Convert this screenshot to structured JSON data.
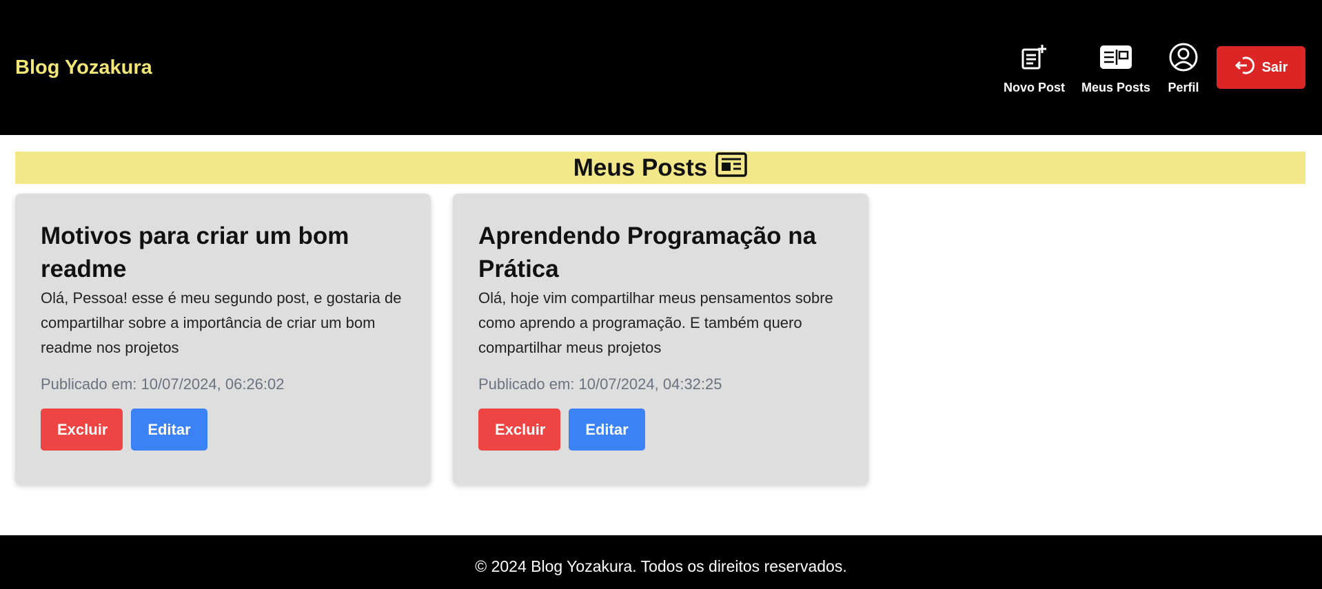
{
  "header": {
    "brand": "Blog Yozakura",
    "nav": [
      {
        "label": "Novo Post",
        "icon": "new-post-icon"
      },
      {
        "label": "Meus Posts",
        "icon": "newspaper-icon"
      },
      {
        "label": "Perfil",
        "icon": "user-circle-icon"
      }
    ],
    "logout_label": "Sair",
    "logout_icon": "logout-arrow-icon"
  },
  "main": {
    "section_title": "Meus Posts",
    "section_icon": "newspaper-icon",
    "posts": [
      {
        "title": "Motivos para criar um bom readme",
        "body": "Olá, Pessoa! esse é meu segundo post, e gostaria de compartilhar sobre a importância de criar um bom readme nos projetos",
        "date": "Publicado em: 10/07/2024, 06:26:02",
        "delete_label": "Excluir",
        "edit_label": "Editar"
      },
      {
        "title": "Aprendendo Programação na Prática",
        "body": "Olá, hoje vim compartilhar meus pensamentos sobre como aprendo a programação. E também quero compartilhar meus projetos",
        "date": "Publicado em: 10/07/2024, 04:32:25",
        "delete_label": "Excluir",
        "edit_label": "Editar"
      }
    ]
  },
  "footer": {
    "text": "© 2024 Blog Yozakura. Todos os direitos reservados."
  },
  "colors": {
    "header_bg": "#000000",
    "brand": "#f2e679",
    "section_bg": "#f2e88a",
    "card_bg": "#dedede",
    "delete": "#ef4444",
    "edit": "#3b82f6",
    "logout": "#dc2626"
  }
}
